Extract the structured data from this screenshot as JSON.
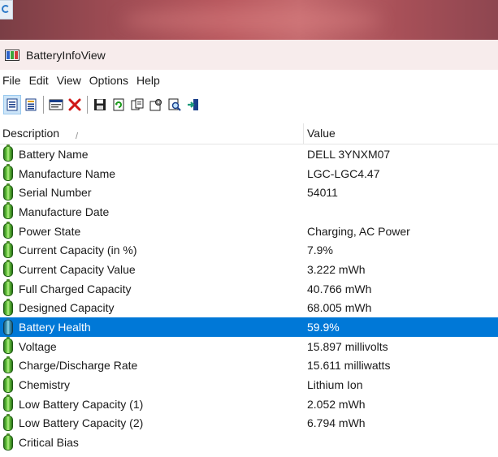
{
  "window": {
    "title": "BatteryInfoView"
  },
  "menu": [
    "File",
    "Edit",
    "View",
    "Options",
    "Help"
  ],
  "toolbar": {
    "buttons": [
      "html-report-all-icon",
      "html-report-selected-icon",
      "properties-icon",
      "delete-icon",
      "save-icon",
      "refresh-icon",
      "copy-icon",
      "options-icon",
      "find-icon",
      "exit-icon"
    ]
  },
  "columns": {
    "description": "Description",
    "value": "Value"
  },
  "rows": [
    {
      "description": "Battery Name",
      "value": "DELL 3YNXM07"
    },
    {
      "description": "Manufacture Name",
      "value": "LGC-LGC4.47"
    },
    {
      "description": "Serial Number",
      "value": "54011"
    },
    {
      "description": "Manufacture Date",
      "value": ""
    },
    {
      "description": "Power State",
      "value": "Charging, AC Power"
    },
    {
      "description": "Current Capacity (in %)",
      "value": "7.9%"
    },
    {
      "description": "Current Capacity Value",
      "value": "3.222 mWh"
    },
    {
      "description": "Full Charged Capacity",
      "value": "40.766 mWh"
    },
    {
      "description": "Designed Capacity",
      "value": "68.005 mWh"
    },
    {
      "description": "Battery Health",
      "value": "59.9%",
      "selected": true
    },
    {
      "description": "Voltage",
      "value": "15.897 millivolts"
    },
    {
      "description": "Charge/Discharge Rate",
      "value": "15.611 milliwatts"
    },
    {
      "description": "Chemistry",
      "value": "Lithium Ion"
    },
    {
      "description": "Low Battery Capacity (1)",
      "value": "2.052 mWh"
    },
    {
      "description": "Low Battery Capacity (2)",
      "value": "6.794 mWh"
    },
    {
      "description": "Critical Bias",
      "value": ""
    }
  ],
  "colors": {
    "selection": "#0078d7",
    "titlebar": "#f7ecec"
  }
}
